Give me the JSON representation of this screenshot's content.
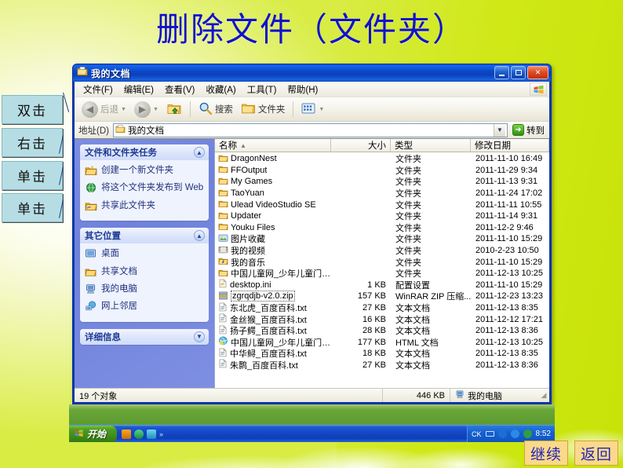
{
  "slide": {
    "title": "删除文件（文件夹）",
    "annotations": [
      {
        "id": "anno-1",
        "label": "双击"
      },
      {
        "id": "anno-2",
        "label": "右击"
      },
      {
        "id": "anno-3",
        "label": "单击"
      },
      {
        "id": "anno-4",
        "label": "单击"
      }
    ],
    "nav": {
      "continue_label": "继续",
      "back_label": "返回"
    },
    "accent_blue": "#1111cc",
    "button_bg": "#fbd98a"
  },
  "window": {
    "title": "我的文档",
    "titlebar_icon": "folder-icon",
    "controls": {
      "minimize": "–",
      "maximize": "❐",
      "close": "✕"
    },
    "menu": [
      {
        "label": "文件(F)"
      },
      {
        "label": "编辑(E)"
      },
      {
        "label": "查看(V)"
      },
      {
        "label": "收藏(A)"
      },
      {
        "label": "工具(T)"
      },
      {
        "label": "帮助(H)"
      }
    ],
    "toolbar": {
      "back_label": "后退",
      "forward_label": "",
      "up_label": "",
      "search_label": "搜索",
      "folders_label": "文件夹",
      "views_label": ""
    },
    "address": {
      "label": "地址(D)",
      "value": "我的文档",
      "go_label": "转到"
    },
    "statusbar": {
      "count": "19 个对象",
      "size": "446 KB",
      "place": "我的电脑"
    }
  },
  "sidebar": {
    "panels": [
      {
        "title": "文件和文件夹任务",
        "collapse_icon": "chevron-up-icon",
        "items": [
          {
            "icon": "new-folder-icon",
            "label": "创建一个新文件夹"
          },
          {
            "icon": "publish-web-icon",
            "label": "将这个文件夹发布到 Web"
          },
          {
            "icon": "share-folder-icon",
            "label": "共享此文件夹"
          }
        ]
      },
      {
        "title": "其它位置",
        "collapse_icon": "chevron-up-icon",
        "items": [
          {
            "icon": "desktop-icon",
            "label": "桌面"
          },
          {
            "icon": "shared-docs-icon",
            "label": "共享文档"
          },
          {
            "icon": "my-computer-icon",
            "label": "我的电脑"
          },
          {
            "icon": "network-icon",
            "label": "网上邻居"
          }
        ]
      },
      {
        "title": "详细信息",
        "collapse_icon": "chevron-down-icon",
        "items": []
      }
    ]
  },
  "filelist": {
    "columns": [
      {
        "key": "name",
        "label": "名称",
        "sorted": "asc"
      },
      {
        "key": "size",
        "label": "大小"
      },
      {
        "key": "type",
        "label": "类型"
      },
      {
        "key": "date",
        "label": "修改日期"
      }
    ],
    "rows": [
      {
        "icon": "folder-icon",
        "name": "DragonNest",
        "size": "",
        "type": "文件夹",
        "date": "2011-11-10 16:49",
        "selected": false
      },
      {
        "icon": "folder-icon",
        "name": "FFOutput",
        "size": "",
        "type": "文件夹",
        "date": "2011-11-29 9:34",
        "selected": false
      },
      {
        "icon": "folder-icon",
        "name": "My Games",
        "size": "",
        "type": "文件夹",
        "date": "2011-11-13 9:31",
        "selected": false
      },
      {
        "icon": "folder-icon",
        "name": "TaoYuan",
        "size": "",
        "type": "文件夹",
        "date": "2011-11-24 17:02",
        "selected": false
      },
      {
        "icon": "folder-icon",
        "name": "Ulead VideoStudio SE",
        "size": "",
        "type": "文件夹",
        "date": "2011-11-11 10:55",
        "selected": false
      },
      {
        "icon": "folder-icon",
        "name": "Updater",
        "size": "",
        "type": "文件夹",
        "date": "2011-11-14 9:31",
        "selected": false
      },
      {
        "icon": "folder-icon",
        "name": "Youku Files",
        "size": "",
        "type": "文件夹",
        "date": "2011-12-2 9:46",
        "selected": false
      },
      {
        "icon": "pictures-folder-icon",
        "name": "图片收藏",
        "size": "",
        "type": "文件夹",
        "date": "2011-11-10 15:29",
        "selected": false
      },
      {
        "icon": "video-folder-icon",
        "name": "我的视频",
        "size": "",
        "type": "文件夹",
        "date": "2010-2-23 10:50",
        "selected": false
      },
      {
        "icon": "music-folder-icon",
        "name": "我的音乐",
        "size": "",
        "type": "文件夹",
        "date": "2011-11-10 15:29",
        "selected": false
      },
      {
        "icon": "folder-icon",
        "name": "中国儿童网_少年儿童门户...",
        "size": "",
        "type": "文件夹",
        "date": "2011-12-13 10:25",
        "selected": false
      },
      {
        "icon": "ini-file-icon",
        "name": "desktop.ini",
        "size": "1 KB",
        "type": "配置设置",
        "date": "2011-11-10 15:29",
        "selected": false
      },
      {
        "icon": "zip-file-icon",
        "name": "zgrqdjb-v2.0.zip",
        "size": "157 KB",
        "type": "WinRAR ZIP 压缩...",
        "date": "2011-12-23 13:23",
        "selected": true
      },
      {
        "icon": "text-file-icon",
        "name": "东北虎_百度百科.txt",
        "size": "27 KB",
        "type": "文本文档",
        "date": "2011-12-13 8:35",
        "selected": false
      },
      {
        "icon": "text-file-icon",
        "name": "金丝猴_百度百科.txt",
        "size": "16 KB",
        "type": "文本文档",
        "date": "2011-12-12 17:21",
        "selected": false
      },
      {
        "icon": "text-file-icon",
        "name": "扬子鳄_百度百科.txt",
        "size": "28 KB",
        "type": "文本文档",
        "date": "2011-12-13 8:36",
        "selected": false
      },
      {
        "icon": "html-file-icon",
        "name": "中国儿童网_少年儿童门户...",
        "size": "177 KB",
        "type": "HTML 文档",
        "date": "2011-12-13 10:25",
        "selected": false
      },
      {
        "icon": "text-file-icon",
        "name": "中华鲟_百度百科.txt",
        "size": "18 KB",
        "type": "文本文档",
        "date": "2011-12-13 8:35",
        "selected": false
      },
      {
        "icon": "text-file-icon",
        "name": "朱鹮_百度百科.txt",
        "size": "27 KB",
        "type": "文本文档",
        "date": "2011-12-13 8:36",
        "selected": false
      }
    ]
  },
  "taskbar": {
    "start_label": "开始",
    "overflow": "»",
    "clock": "8:52"
  }
}
